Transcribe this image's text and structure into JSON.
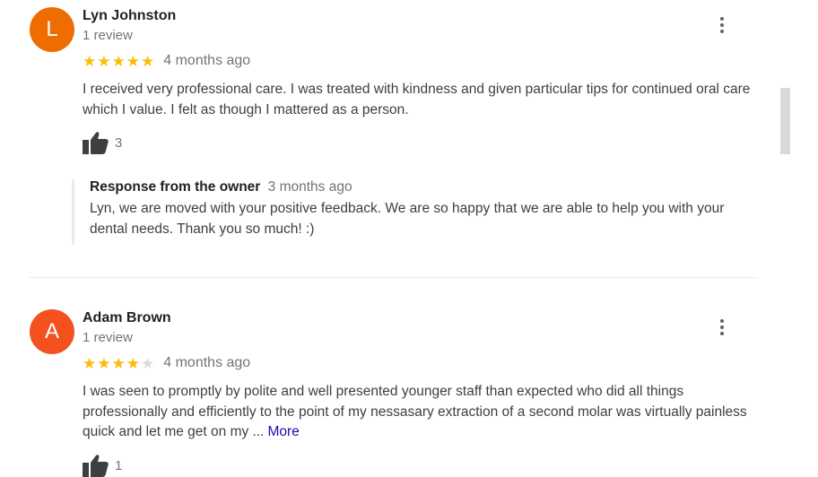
{
  "reviews": [
    {
      "initial": "L",
      "avatar_color": "#ef6c00",
      "name": "Lyn Johnston",
      "review_count": "1 review",
      "rating": 5,
      "date": "4 months ago",
      "text": "I received very professional care. I was treated with kindness and given particular tips for continued oral care which I value. I felt as though I mattered as a person.",
      "likes": "3",
      "response": {
        "title": "Response from the owner",
        "date": "3 months ago",
        "text": "Lyn, we are moved with your positive feedback. We are so happy that we are able to help you with your dental needs. Thank you so much! :)"
      }
    },
    {
      "initial": "A",
      "avatar_color": "#f4511e",
      "name": "Adam Brown",
      "review_count": "1 review",
      "rating": 4,
      "date": "4 months ago",
      "text": "I was seen to promptly by polite and well presented younger staff than expected who did all things professionally and efficiently to the point of my nessasary extraction of a second molar was virtually painless quick and let me get on my ...",
      "more_label": "More",
      "likes": "1"
    }
  ],
  "icons": {
    "star": "star-icon",
    "menu": "more-vert-icon",
    "like": "thumb-up-icon"
  }
}
